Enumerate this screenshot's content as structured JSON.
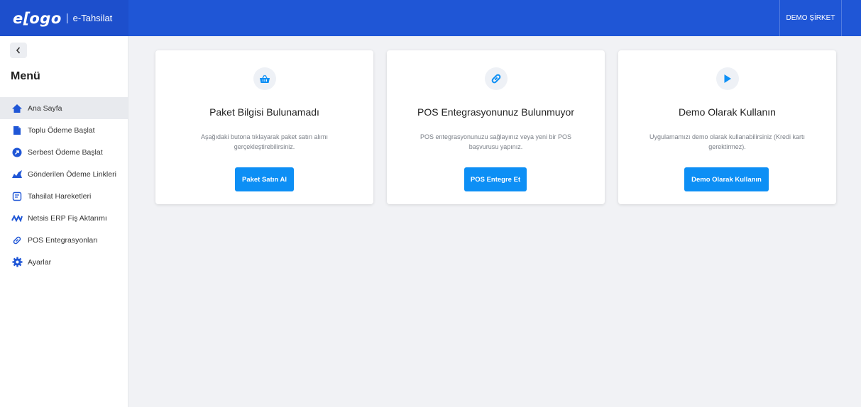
{
  "header": {
    "logo_text": "e-logo",
    "app_name": "e-Tahsilat",
    "company": "DEMO ŞİRKET"
  },
  "sidebar": {
    "title": "Menü",
    "items": [
      {
        "label": "Ana Sayfa",
        "icon": "home-icon",
        "active": true
      },
      {
        "label": "Toplu Ödeme Başlat",
        "icon": "file-icon",
        "active": false
      },
      {
        "label": "Serbest Ödeme Başlat",
        "icon": "arrow-circle-icon",
        "active": false
      },
      {
        "label": "Gönderilen Ödeme Linkleri",
        "icon": "sent-links-icon",
        "active": false
      },
      {
        "label": "Tahsilat Hareketleri",
        "icon": "transactions-icon",
        "active": false
      },
      {
        "label": "Netsis ERP Fiş Aktarımı",
        "icon": "transfer-icon",
        "active": false
      },
      {
        "label": "POS Entegrasyonları",
        "icon": "link-icon",
        "active": false
      },
      {
        "label": "Ayarlar",
        "icon": "gear-icon",
        "active": false
      }
    ]
  },
  "cards": [
    {
      "icon": "basket-icon",
      "title": "Paket Bilgisi Bulunamadı",
      "description": "Aşağıdaki butona tıklayarak paket satın alımı gerçekleştirebilirsiniz.",
      "button": "Paket Satın Al"
    },
    {
      "icon": "link-icon",
      "title": "POS Entegrasyonunuz Bulunmuyor",
      "description": "POS entegrasyonunuzu sağlayınız veya yeni bir POS başvurusu yapınız.",
      "button": "POS Entegre Et"
    },
    {
      "icon": "play-icon",
      "title": "Demo Olarak Kullanın",
      "description": "Uygulamamızı demo olarak kullanabilirsiniz (Kredi kartı gerektirmez).",
      "button": "Demo Olarak Kullanın"
    }
  ],
  "colors": {
    "header": "#1f56d6",
    "accent": "#0d8ff5",
    "background": "#f1f2f5"
  }
}
